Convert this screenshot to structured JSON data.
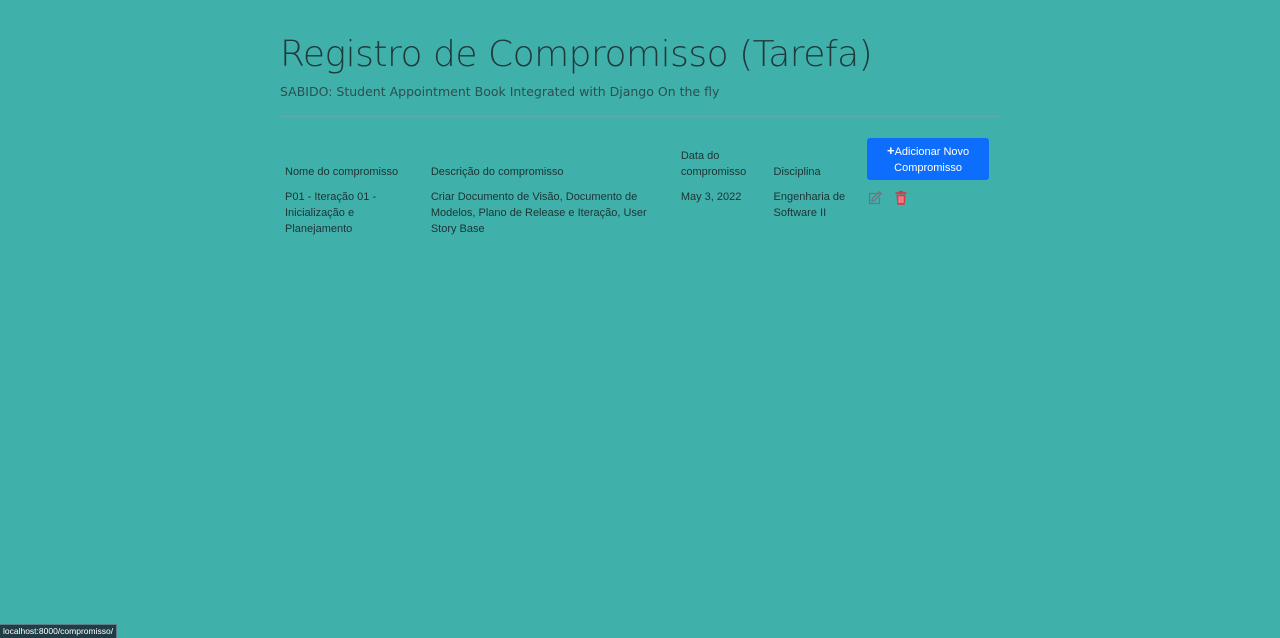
{
  "header": {
    "title": "Registro de Compromisso (Tarefa)",
    "subtitle": "SABIDO: Student Appointment Book Integrated with Django On the fly"
  },
  "table": {
    "columns": [
      "Nome do compromisso",
      "Descrição do compromisso",
      "Data do compromisso",
      "Disciplina"
    ],
    "add_button": {
      "icon": "plus-icon",
      "label": "Adicionar Novo Compromisso"
    },
    "rows": [
      {
        "nome": "P01 - Iteração 01 - Inicialização e Planejamento",
        "descricao": "Criar Documento de Visão, Documento de Modelos, Plano de Release e Iteração, User Story Base",
        "data": "May 3, 2022",
        "disciplina": "Engenharia de Software II",
        "actions": [
          "edit-icon",
          "trash-icon"
        ]
      }
    ]
  },
  "status_bar": {
    "url": "localhost:8000/compromisso/"
  },
  "colors": {
    "background": "#40b0ab",
    "primary": "#0d6efd",
    "edit": "#6c757d",
    "delete": "#dc3545"
  }
}
